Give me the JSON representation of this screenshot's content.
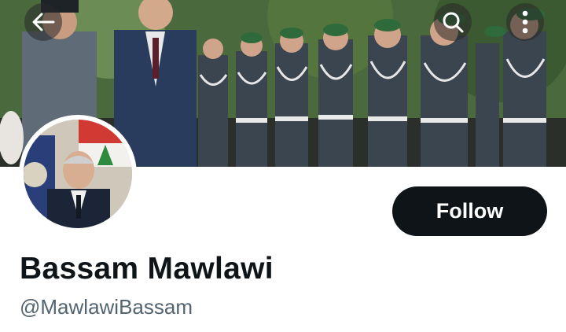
{
  "header": {
    "back_icon": "arrow-left-icon",
    "search_icon": "search-icon",
    "more_icon": "more-vertical-icon"
  },
  "profile": {
    "display_name": "Bassam Mawlawi",
    "handle": "@MawlawiBassam",
    "follow_label": "Follow"
  },
  "colors": {
    "follow_bg": "#0f1419",
    "follow_text": "#ffffff",
    "name_text": "#0f1419",
    "handle_text": "#536471"
  }
}
